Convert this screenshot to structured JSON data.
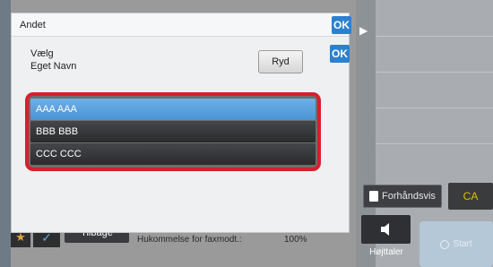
{
  "dialog": {
    "title": "Andet",
    "ok_label": "OK",
    "field_label_line1": "Vælg",
    "field_label_line2": "Eget Navn",
    "clear_label": "Ryd",
    "list_items": [
      "AAA AAA",
      "BBB BBB",
      "CCC CCC"
    ],
    "selected_index": 0
  },
  "right_panel": {
    "preview_label": "Forhåndsvis",
    "ca_label": "CA",
    "speaker_label": "Højttaler",
    "start_label": "Start"
  },
  "bottom_bar": {
    "back_label": "Tilbage",
    "memory_label": "Hukommelse for faxmodt.:",
    "memory_value": "100%"
  },
  "colors": {
    "accent": "#2c80d0",
    "highlight_border": "#d6202c",
    "selected_item": "#5aa3e0",
    "ca_text": "#d8c400"
  }
}
